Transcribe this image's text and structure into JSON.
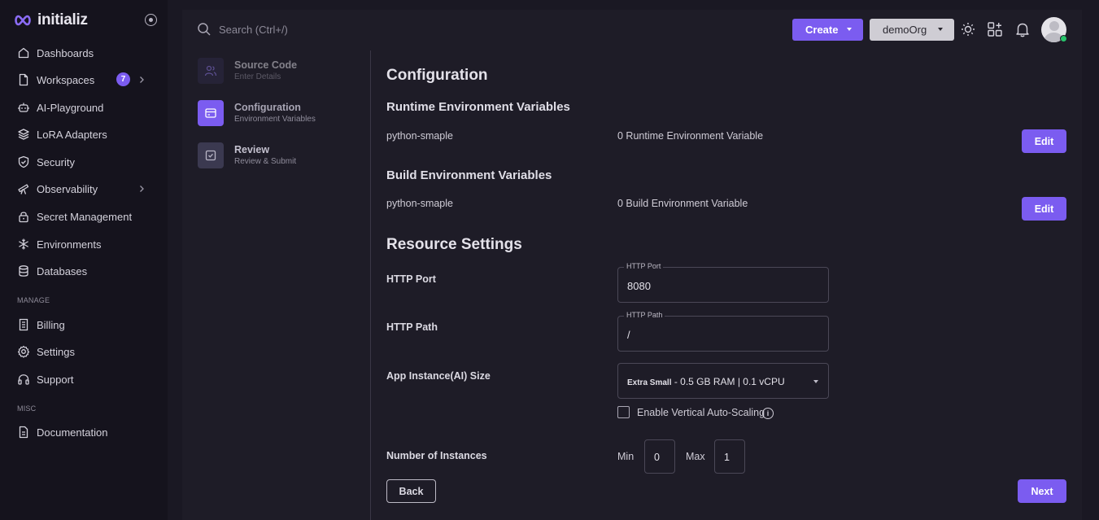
{
  "brand": {
    "name": "initializ"
  },
  "sidebar": {
    "items": [
      {
        "label": "Dashboards",
        "icon": "home-icon"
      },
      {
        "label": "Workspaces",
        "icon": "file-icon",
        "badge": "7"
      },
      {
        "label": "AI-Playground",
        "icon": "robot-icon"
      },
      {
        "label": "LoRA Adapters",
        "icon": "layers-icon"
      },
      {
        "label": "Security",
        "icon": "shield-icon"
      },
      {
        "label": "Observability",
        "icon": "telescope-icon"
      },
      {
        "label": "Secret Management",
        "icon": "lock-icon"
      },
      {
        "label": "Environments",
        "icon": "snowflake-icon"
      },
      {
        "label": "Databases",
        "icon": "database-icon"
      }
    ],
    "manage_title": "MANAGE",
    "manage_items": [
      {
        "label": "Billing",
        "icon": "receipt-icon"
      },
      {
        "label": "Settings",
        "icon": "gear-icon"
      },
      {
        "label": "Support",
        "icon": "headphones-icon"
      }
    ],
    "misc_title": "MISC",
    "misc_items": [
      {
        "label": "Documentation",
        "icon": "document-icon"
      }
    ]
  },
  "topbar": {
    "search_placeholder": "Search (Ctrl+/)",
    "create_label": "Create",
    "org_label": "demoOrg"
  },
  "stepper": [
    {
      "title": "Source Code",
      "subtitle": "Enter Details",
      "state": "done"
    },
    {
      "title": "Configuration",
      "subtitle": "Environment Variables",
      "state": "active"
    },
    {
      "title": "Review",
      "subtitle": "Review & Submit",
      "state": "pending"
    }
  ],
  "config": {
    "heading": "Configuration",
    "runtime": {
      "heading": "Runtime Environment Variables",
      "name": "python-smaple",
      "count": "0 Runtime Environment Variable",
      "edit_label": "Edit"
    },
    "build": {
      "heading": "Build Environment Variables",
      "name": "python-smaple",
      "count": "0 Build Environment Variable",
      "edit_label": "Edit"
    }
  },
  "resources": {
    "heading": "Resource Settings",
    "http_port": {
      "label": "HTTP Port",
      "legend": "HTTP Port",
      "value": "8080"
    },
    "http_path": {
      "label": "HTTP Path",
      "legend": "HTTP Path",
      "value": "/"
    },
    "instance_size": {
      "label": "App Instance(AI) Size",
      "size_name": "Extra Small",
      "size_detail": " - 0.5 GB RAM | 0.1 vCPU"
    },
    "autoscaling": {
      "label": "Enable Vertical Auto-Scaling",
      "checked": false
    },
    "instances": {
      "label": "Number of Instances",
      "min_label": "Min",
      "min_value": "0",
      "max_label": "Max",
      "max_value": "1"
    }
  },
  "footer": {
    "back_label": "Back",
    "next_label": "Next"
  },
  "colors": {
    "accent": "#7b5cf0",
    "background": "#1a1823",
    "sidebar": "#15131d",
    "panel": "#1e1c27",
    "online": "#27c46b"
  }
}
